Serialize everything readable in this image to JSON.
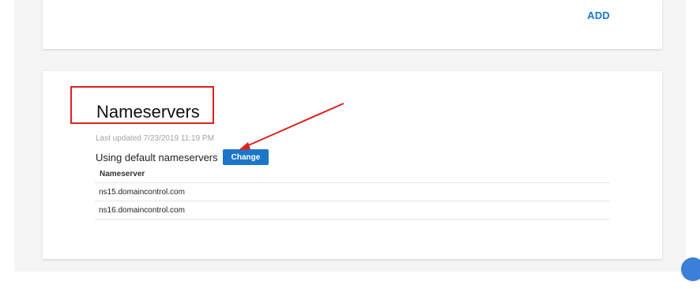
{
  "top_card": {
    "add_label": "ADD"
  },
  "nameservers": {
    "title": "Nameservers",
    "last_updated": "Last updated 7/23/2019 11:19 PM",
    "status_text": "Using default nameservers",
    "change_label": "Change",
    "table": {
      "header": "Nameserver",
      "rows": [
        "ns15.domaincontrol.com",
        "ns16.domaincontrol.com"
      ]
    }
  },
  "colors": {
    "accent": "#1b76c9",
    "annotation": "#e0201c",
    "page_bg": "#f5f5f5"
  }
}
